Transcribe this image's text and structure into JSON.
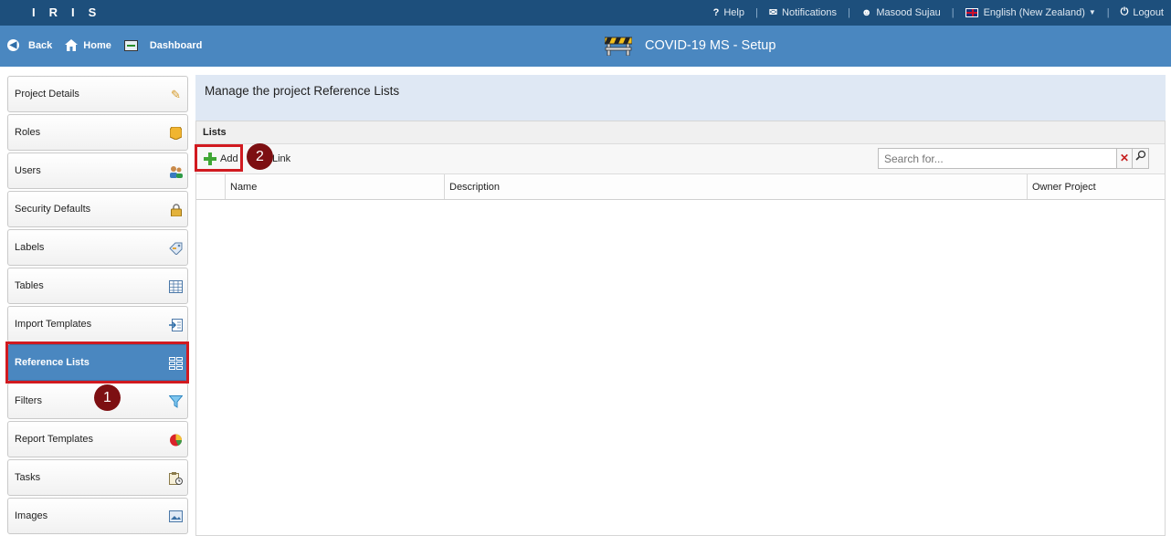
{
  "topbar": {
    "logo": "IRIS",
    "help": "Help",
    "notifications": "Notifications",
    "user": "Masood Sujau",
    "language": "English (New Zealand)",
    "logout": "Logout"
  },
  "nav": {
    "back": "Back",
    "home": "Home",
    "dashboard": "Dashboard",
    "title": "COVID-19 MS - Setup"
  },
  "sidebar": {
    "items": [
      {
        "label": "Project Details",
        "icon": "pencil-icon"
      },
      {
        "label": "Roles",
        "icon": "badge-icon"
      },
      {
        "label": "Users",
        "icon": "users-icon"
      },
      {
        "label": "Security Defaults",
        "icon": "lock-icon"
      },
      {
        "label": "Labels",
        "icon": "labels-icon"
      },
      {
        "label": "Tables",
        "icon": "table-icon"
      },
      {
        "label": "Import Templates",
        "icon": "import-icon"
      },
      {
        "label": "Reference Lists",
        "icon": "list-icon"
      },
      {
        "label": "Filters",
        "icon": "filter-icon"
      },
      {
        "label": "Report Templates",
        "icon": "report-icon"
      },
      {
        "label": "Tasks",
        "icon": "tasks-icon"
      },
      {
        "label": "Images",
        "icon": "image-icon"
      }
    ],
    "active_index": 7
  },
  "main": {
    "heading": "Manage the project Reference Lists",
    "panel_title": "Lists",
    "add_label": "Add",
    "link_label": "Link",
    "search_placeholder": "Search for...",
    "columns": [
      "",
      "Name",
      "Description",
      "Owner Project"
    ]
  },
  "annotations": {
    "step1": "1",
    "step2": "2"
  },
  "colors": {
    "topbar": "#1d4f7c",
    "navbar": "#4a87c0",
    "highlight": "#d11a20",
    "badge": "#7d0f12"
  }
}
